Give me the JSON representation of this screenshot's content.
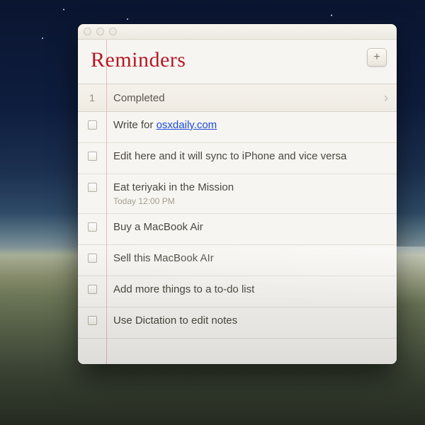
{
  "window": {
    "title": "Reminders",
    "add_tooltip": "+"
  },
  "completed": {
    "count": "1",
    "label": "Completed"
  },
  "items": [
    {
      "prefix": "Write for ",
      "link": "osxdaily.com",
      "sub": ""
    },
    {
      "text": "Edit here and it will sync to iPhone and vice versa",
      "sub": ""
    },
    {
      "text": "Eat teriyaki in the Mission",
      "sub": "Today 12:00 PM"
    },
    {
      "text": "Buy a MacBook Air",
      "sub": ""
    },
    {
      "text": "Sell this MacBook AIr",
      "sub": ""
    },
    {
      "text": "Add more things to a to-do list",
      "sub": ""
    },
    {
      "text": "Use Dictation to edit notes",
      "sub": ""
    }
  ]
}
